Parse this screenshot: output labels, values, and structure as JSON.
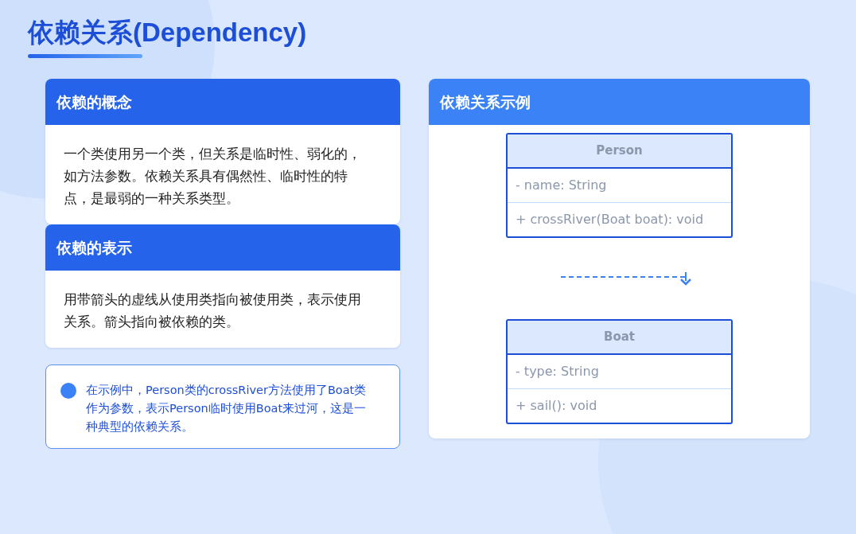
{
  "title": "依赖关系(Dependency)",
  "sections": [
    {
      "heading": "依赖的概念",
      "body": "一个类使用另一个类，但关系是临时性、弱化的，如方法参数。依赖关系具有偶然性、临时性的特点，是最弱的一种关系类型。"
    },
    {
      "heading": "依赖的表示",
      "body": "用带箭头的虚线从使用类指向被使用类，表示使用关系。箭头指向被依赖的类。"
    }
  ],
  "note": {
    "text": "在示例中，Person类的crossRiver方法使用了Boat类作为参数，表示Person临时使用Boat来过河，这是一种典型的依赖关系。"
  },
  "example": {
    "heading": "依赖关系示例",
    "classes": [
      {
        "name": "Person",
        "members": [
          "- name: String",
          "+ crossRiver(Boat boat): void"
        ]
      },
      {
        "name": "Boat",
        "members": [
          "- type: String",
          "+ sail(): void"
        ]
      }
    ]
  }
}
